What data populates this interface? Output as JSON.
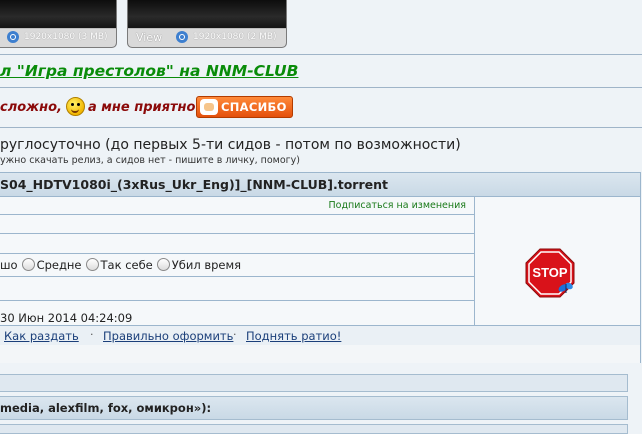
{
  "thumbnails": [
    {
      "view_label": "View",
      "resolution": "1920x1080 (3 MB)"
    },
    {
      "view_label": "View",
      "resolution": "1920x1080 (2 MB)"
    }
  ],
  "post": {
    "link_title": "л \"Игра престолов\" на NNM-CLUB",
    "thanks_text": "сложно,",
    "thanks_text2": "а мне приятно",
    "thanks_button": "СПАСИБО",
    "seed_line": "руглосуточно (до первых 5-ти сидов - потом по возможности)",
    "seed_note": "ужно скачать релиз, а сидов нет - пишите в личку, помогу)"
  },
  "torrent": {
    "filename": "S04_HDTV1080i_(3xRus_Ukr_Eng)]_[NNM-CLUB].torrent",
    "subscribe_link": "Подписаться на изменения",
    "rating_options": [
      "шо",
      "Средне",
      "Так себе",
      "Убил время"
    ],
    "date": "30 Июн 2014 04:24:09",
    "stop_label": "STOP",
    "links": [
      "Как раздать",
      "Правильно оформить",
      "Поднять ратио!"
    ],
    "links_separator": "·"
  },
  "bottom": {
    "section_title": "media, alexfilm, fox, омикрон»):"
  },
  "colors": {
    "link_green": "#0a8c0a",
    "thanks_red": "#8b0a0a",
    "button_orange": "#e4500c",
    "border_blue": "#9cb6cd"
  }
}
